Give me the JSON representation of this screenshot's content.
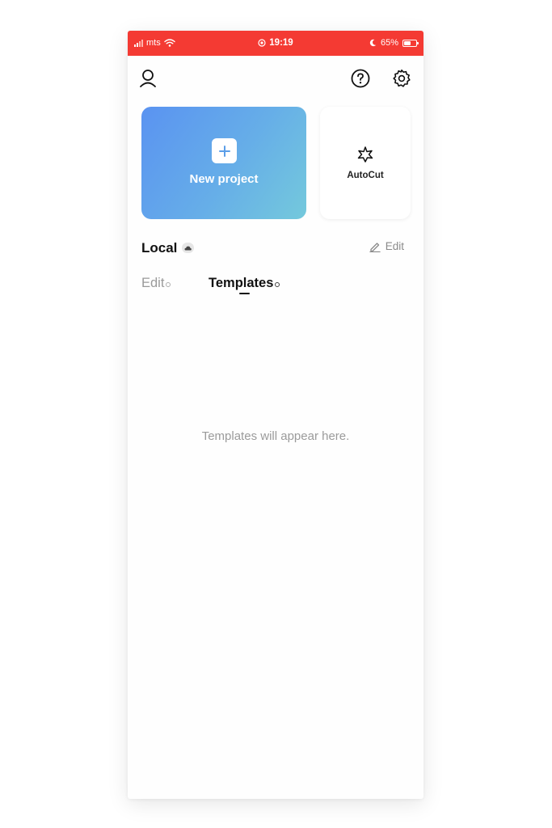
{
  "status_bar": {
    "carrier": "mts",
    "time": "19:19",
    "battery": "65%",
    "battery_level": 0.65,
    "background_color": "#f43a33",
    "icons": [
      "signal-icon",
      "wifi-icon",
      "location-icon",
      "moon-icon",
      "battery-icon"
    ]
  },
  "top_bar": {
    "icons": [
      "profile-icon",
      "help-icon",
      "settings-icon"
    ]
  },
  "cards": {
    "new_project": {
      "label": "New project",
      "icon": "plus-icon",
      "gradient": [
        "#5a93f1",
        "#74c9dc"
      ]
    },
    "autocut": {
      "label": "AutoCut",
      "icon": "autocut-star-icon"
    }
  },
  "local_section": {
    "title": "Local",
    "badge_icon": "cloud-icon",
    "edit_label": "Edit",
    "edit_icon": "pencil-icon"
  },
  "tabs": [
    {
      "label": "Edit",
      "active": false
    },
    {
      "label": "Templates",
      "active": true
    }
  ],
  "empty_state": {
    "message": "Templates will appear here."
  }
}
